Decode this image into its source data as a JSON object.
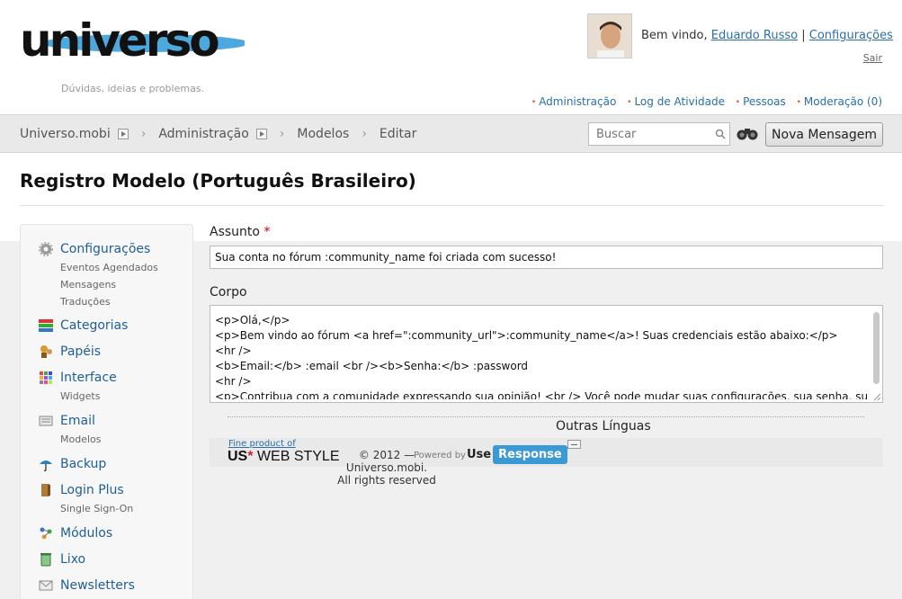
{
  "header": {
    "logo_text": "universo",
    "tagline": "Dúvidas, ideias e problemas.",
    "welcome_prefix": "Bem vindo,",
    "user_name": "Eduardo Russo",
    "separator": "|",
    "settings_link": "Configurações",
    "logout": "Sair",
    "admin_links": [
      "Administração",
      "Log de Atividade",
      "Pessoas",
      "Moderação (0)"
    ]
  },
  "navbar": {
    "breadcrumbs": [
      "Universo.mobi",
      "Administração",
      "Modelos",
      "Editar"
    ],
    "search_placeholder": "Buscar",
    "new_message_label": "Nova Mensagem"
  },
  "page": {
    "title": "Registro Modelo (Português Brasileiro)"
  },
  "sidebar": {
    "items": [
      {
        "label": "Configurações",
        "icon": "gear-icon",
        "subs": [
          "Eventos Agendados",
          "Mensagens",
          "Traduções"
        ]
      },
      {
        "label": "Categorias",
        "icon": "categories-icon",
        "subs": []
      },
      {
        "label": "Papéis",
        "icon": "roles-icon",
        "subs": []
      },
      {
        "label": "Interface",
        "icon": "interface-icon",
        "subs": [
          "Widgets"
        ]
      },
      {
        "label": "Email",
        "icon": "email-icon",
        "subs": [
          "Modelos"
        ]
      },
      {
        "label": "Backup",
        "icon": "umbrella-icon",
        "subs": []
      },
      {
        "label": "Login Plus",
        "icon": "login-icon",
        "subs": [
          "Single Sign-On"
        ]
      },
      {
        "label": "Módulos",
        "icon": "modules-icon",
        "subs": []
      },
      {
        "label": "Lixo",
        "icon": "trash-icon",
        "subs": []
      },
      {
        "label": "Newsletters",
        "icon": "newsletter-icon",
        "subs": []
      }
    ]
  },
  "form": {
    "subject_label": "Assunto",
    "required_mark": "*",
    "subject_value": "Sua conta no fórum :community_name foi criada com sucesso!",
    "body_label": "Corpo",
    "body_value": "<p>Olá,</p>\n<p>Bem vindo ao fórum <a href=\":community_url\">:community_name</a>! Suas credenciais estão abaixo:</p>\n<hr />\n<b>Email:</b> :email <br /><b>Senha:</b> :password\n<hr />\n<p>Contribua com a comunidade expressando sua opinião! <br /> Você pode mudar suas configurações, sua senha, subir"
  },
  "footer": {
    "other_languages": "Outras Línguas",
    "fine_product": "Fine product of",
    "us_label": "US",
    "star": "*",
    "web_style": "WEB STYLE",
    "copyright_line1": "© 2012 —",
    "copyright_line2": "Universo.mobi.",
    "copyright_line3": "All rights reserved",
    "powered_by": "Powered by",
    "use": "Use",
    "response": "Response"
  },
  "colors": {
    "link": "#2a6fa8",
    "bullet": "#e05a2b",
    "required": "#cc0000",
    "response_badge": "#3b9ad6"
  }
}
